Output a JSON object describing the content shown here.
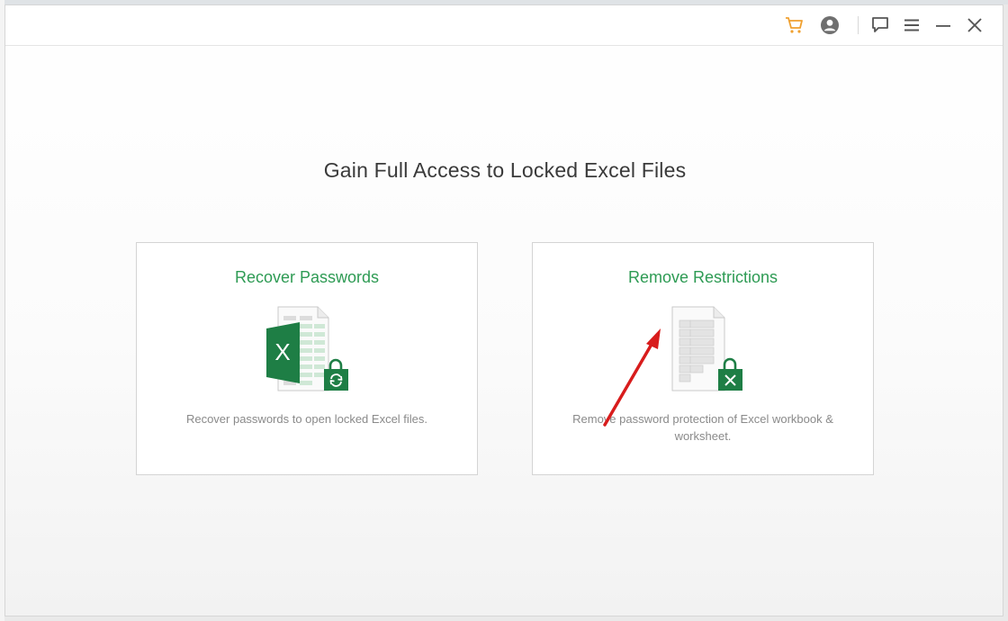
{
  "window": {
    "headline": "Gain Full Access to Locked Excel Files"
  },
  "titlebar": {
    "icons": [
      "cart-icon",
      "account-icon",
      "feedback-icon",
      "menu-icon",
      "minimize-icon",
      "close-icon"
    ]
  },
  "cards": [
    {
      "title": "Recover Passwords",
      "description": "Recover passwords to open locked Excel files.",
      "icon": "excel-recover-icon",
      "excel_letter": "X"
    },
    {
      "title": "Remove Restrictions",
      "description": "Remove password protection of Excel workbook & worksheet.",
      "icon": "excel-unlock-icon"
    }
  ],
  "colors": {
    "accent_green": "#2e9b54",
    "excel_green": "#1e7e45",
    "cart_orange": "#f0a030",
    "annotation_red": "#d81c1c"
  }
}
